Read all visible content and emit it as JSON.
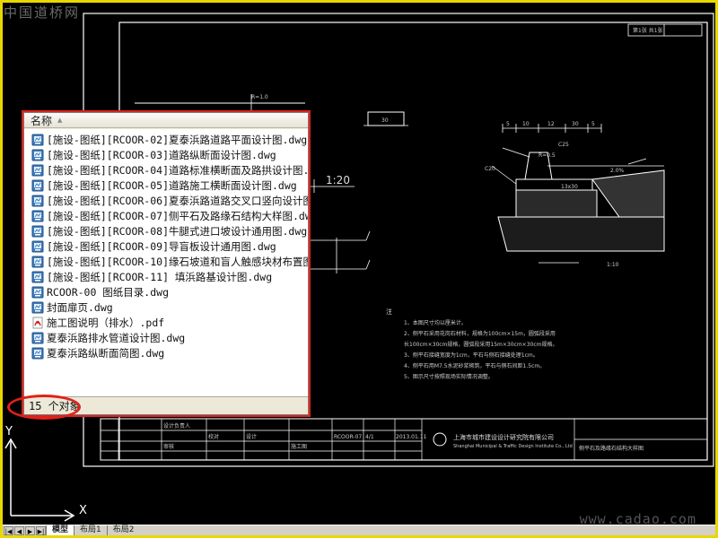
{
  "watermark_top": "中国道桥网",
  "watermark_bottom": "www.cadao.com",
  "explorer": {
    "column_header": "名称",
    "files": [
      {
        "name": "[施设-图纸][RCOOR-02]夏泰浜路道路平面设计图.dwg",
        "icon": "dwg-file-icon"
      },
      {
        "name": "[施设-图纸][RCOOR-03]道路纵断面设计图.dwg",
        "icon": "dwg-file-icon"
      },
      {
        "name": "[施设-图纸][RCOOR-04]道路标准横断面及路拱设计图.",
        "icon": "dwg-file-icon"
      },
      {
        "name": "[施设-图纸][RCOOR-05]道路施工横断面设计图.dwg",
        "icon": "dwg-file-icon"
      },
      {
        "name": "[施设-图纸][RCOOR-06]夏泰浜路道路交叉口竖向设计图",
        "icon": "dwg-file-icon"
      },
      {
        "name": "[施设-图纸][RCOOR-07]侧平石及路缘石结构大样图.dw",
        "icon": "dwg-file-icon"
      },
      {
        "name": "[施设-图纸][RCOOR-08]牛腿式进口坡设计通用图.dwg",
        "icon": "dwg-file-icon"
      },
      {
        "name": "[施设-图纸][RCOOR-09]导盲板设计通用图.dwg",
        "icon": "dwg-file-icon"
      },
      {
        "name": "[施设-图纸][RCOOR-10]缘石坡道和盲人触感块材布置图",
        "icon": "dwg-file-icon"
      },
      {
        "name": "[施设-图纸][RCOOR-11] 填浜路基设计图.dwg",
        "icon": "dwg-file-icon"
      },
      {
        "name": "RCOOR-00 图纸目录.dwg",
        "icon": "dwg-file-icon"
      },
      {
        "name": "封面扉页.dwg",
        "icon": "dwg-file-icon"
      },
      {
        "name": "施工图说明（排水）.pdf",
        "icon": "pdf-file-icon"
      },
      {
        "name": "夏泰浜路排水管道设计图.dwg",
        "icon": "dwg-file-icon"
      },
      {
        "name": "夏泰浜路纵断面简图.dwg",
        "icon": "dwg-file-icon"
      }
    ],
    "status_text": "15 个对象"
  },
  "tabs": {
    "model": "模型",
    "layout1": "布局1",
    "layout2": "布局2"
  },
  "drawing": {
    "scale": "1:20",
    "scale_small": "1:10",
    "sheet_label": "第1张 共1张",
    "dims": [
      "5",
      "10",
      "12",
      "30",
      "5"
    ],
    "slope": "2.0%",
    "dim_r": "R=1.0",
    "dim_size": "13x30",
    "dim_c25": "C25",
    "dim_c20": "C20",
    "dim_r5": "R=0.5",
    "notes_title": "注",
    "notes": [
      "1、本图尺寸均以厘米计。",
      "2、侧平石采用花岗石材料，规格为100cm×15m，圆弧段采用",
      "   长100cm×30cm规格，圆弧段采用15m×30cm×30cm规格。",
      "3、侧平石接缝宽度为1cm，平石与侧石接缝处理1cm。",
      "4、侧平石用M7.5水泥砂浆砌筑，平石与侧石间距1.5cm。",
      "5、图示尺寸按照现场实际情况调整。"
    ],
    "company": "上海市城市建设设计研究院有限公司",
    "company_en": "Shanghai Municipal & Traffic Design Institute Co., Ltd",
    "drawing_title": "侧平石及路缘石结构大样图",
    "titleblock_cells": [
      "设计负责人",
      "审核",
      "校对",
      "设计",
      "2013.01.11",
      "4/1",
      "RCOOR-07",
      "施工图"
    ]
  }
}
